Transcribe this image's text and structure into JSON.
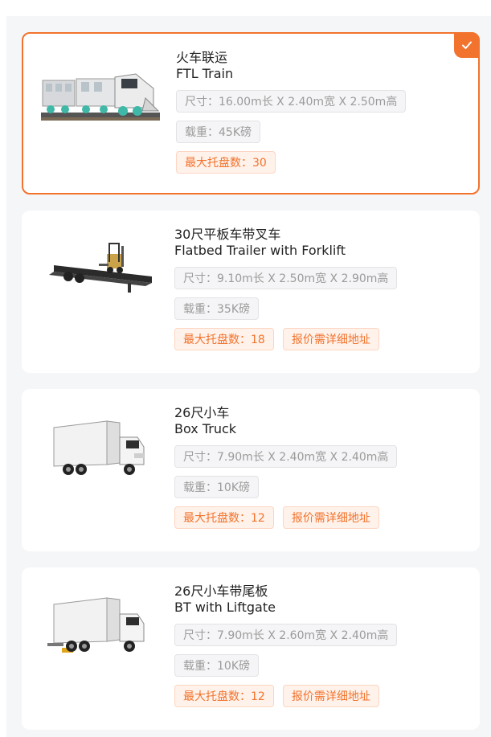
{
  "vehicles": [
    {
      "name_zh": "火车联运",
      "name_en": "FTL Train",
      "size": "尺寸：16.00m长 X 2.40m宽 X 2.50m高",
      "load": "载重：45K磅",
      "pallets": "最大托盘数：30",
      "note": "",
      "selected": true,
      "image_icon": "train-icon"
    },
    {
      "name_zh": "30尺平板车带叉车",
      "name_en": "Flatbed Trailer with Forklift",
      "size": "尺寸：9.10m长 X 2.50m宽 X 2.90m高",
      "load": "载重：35K磅",
      "pallets": "最大托盘数：18",
      "note": "报价需详细地址",
      "selected": false,
      "image_icon": "flatbed-forklift-icon"
    },
    {
      "name_zh": "26尺小车",
      "name_en": "Box Truck",
      "size": "尺寸：7.90m长 X 2.40m宽 X 2.40m高",
      "load": "载重：10K磅",
      "pallets": "最大托盘数：12",
      "note": "报价需详细地址",
      "selected": false,
      "image_icon": "box-truck-icon"
    },
    {
      "name_zh": "26尺小车带尾板",
      "name_en": "BT with Liftgate",
      "size": "尺寸：7.90m长 X 2.60m宽 X 2.40m高",
      "load": "载重：10K磅",
      "pallets": "最大托盘数：12",
      "note": "报价需详细地址",
      "selected": false,
      "image_icon": "box-truck-liftgate-icon"
    }
  ],
  "colors": {
    "accent": "#f2732d",
    "tag_orange_bg": "#fff2ea",
    "tag_gray_bg": "#f5f5f7",
    "page_bg": "#f5f6f8"
  }
}
